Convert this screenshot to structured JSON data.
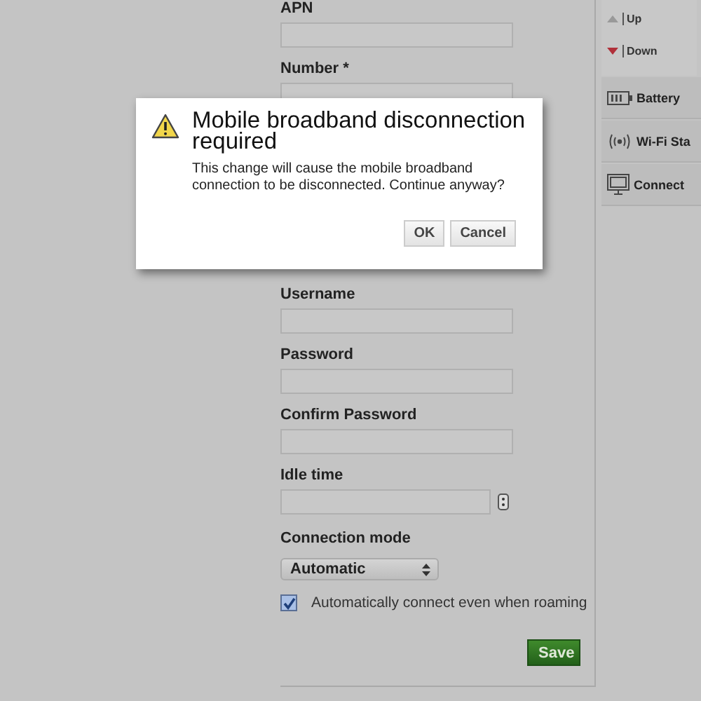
{
  "form": {
    "fields": [
      {
        "label": "APN",
        "kind": "text"
      },
      {
        "label": "Number *",
        "kind": "text"
      },
      {
        "label": "Username",
        "kind": "text"
      },
      {
        "label": "Password",
        "kind": "text"
      },
      {
        "label": "Confirm Password",
        "kind": "text"
      },
      {
        "label": "Idle time",
        "kind": "spinner"
      }
    ],
    "connection_mode": {
      "label": "Connection mode",
      "value": "Automatic"
    },
    "roaming": {
      "label": "Automatically connect even when roaming",
      "checked": true
    },
    "save_button": "Save"
  },
  "sidebar": {
    "traffic": [
      {
        "label": "Up",
        "kind": "up"
      },
      {
        "label": "Down",
        "kind": "down"
      }
    ],
    "items": [
      {
        "label": "Battery",
        "kind": "battery"
      },
      {
        "label": "Wi-Fi Sta",
        "kind": "wifi"
      },
      {
        "label": "Connect",
        "kind": "monitor"
      }
    ]
  },
  "dialog": {
    "title": "Mobile broadband disconnection required",
    "message": "This change will cause the mobile broadband connection to be disconnected. Continue anyway?",
    "buttons": [
      "OK",
      "Cancel"
    ]
  }
}
